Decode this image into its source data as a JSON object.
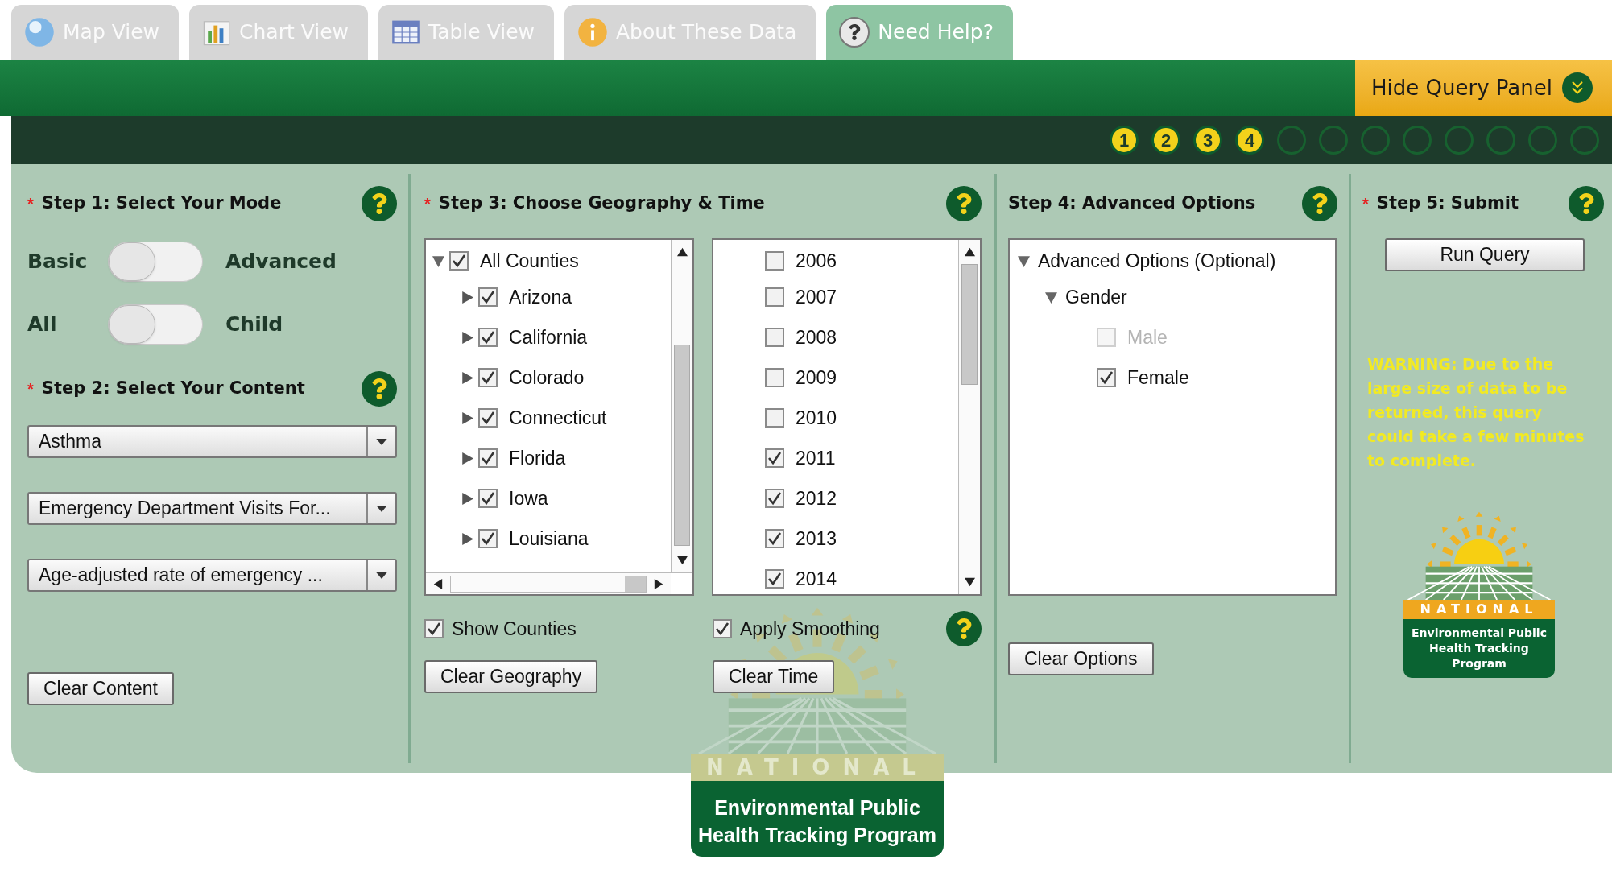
{
  "tabs": [
    {
      "label": "Map View",
      "selected": false
    },
    {
      "label": "Chart View",
      "selected": false
    },
    {
      "label": "Table View",
      "selected": false
    },
    {
      "label": "About These Data",
      "selected": false
    },
    {
      "label": "Need Help?",
      "selected": true
    }
  ],
  "hide_panel": {
    "label": "Hide Query Panel"
  },
  "steps": [
    {
      "label": "1",
      "done": true
    },
    {
      "label": "2",
      "done": true
    },
    {
      "label": "3",
      "done": true
    },
    {
      "label": "4",
      "done": true
    },
    {
      "done": false
    },
    {
      "done": false
    },
    {
      "done": false
    },
    {
      "done": false
    },
    {
      "done": false
    },
    {
      "done": false
    },
    {
      "done": false
    },
    {
      "done": false
    }
  ],
  "step1": {
    "title": "Step 1: Select Your Mode",
    "marker": "*",
    "toggles": [
      {
        "left": "Basic",
        "right": "Advanced",
        "on": false
      },
      {
        "left": "All",
        "right": "Child",
        "on": false
      }
    ]
  },
  "step2": {
    "title": "Step 2: Select Your Content",
    "marker": "*",
    "dropdowns": [
      "Asthma",
      "Emergency Department Visits For...",
      "Age-adjusted rate of emergency ..."
    ],
    "clear": "Clear Content"
  },
  "step3": {
    "title": "Step 3: Choose Geography & Time",
    "marker": "*",
    "geography": {
      "label": "All Counties",
      "checked": true,
      "expanded": true,
      "children": [
        {
          "label": "Arizona",
          "checked": true,
          "expanded": false
        },
        {
          "label": "California",
          "checked": true,
          "expanded": false
        },
        {
          "label": "Colorado",
          "checked": true,
          "expanded": false
        },
        {
          "label": "Connecticut",
          "checked": true,
          "expanded": false
        },
        {
          "label": "Florida",
          "checked": true,
          "expanded": false
        },
        {
          "label": "Iowa",
          "checked": true,
          "expanded": false
        },
        {
          "label": "Louisiana",
          "checked": true,
          "expanded": false
        }
      ]
    },
    "years": [
      {
        "label": "2006",
        "checked": false
      },
      {
        "label": "2007",
        "checked": false
      },
      {
        "label": "2008",
        "checked": false
      },
      {
        "label": "2009",
        "checked": false
      },
      {
        "label": "2010",
        "checked": false
      },
      {
        "label": "2011",
        "checked": true
      },
      {
        "label": "2012",
        "checked": true
      },
      {
        "label": "2013",
        "checked": true
      },
      {
        "label": "2014",
        "checked": true
      }
    ],
    "show_counties": {
      "label": "Show Counties",
      "checked": true
    },
    "smoothing": {
      "label": "Apply Smoothing",
      "checked": true
    },
    "clear_geography": "Clear Geography",
    "clear_time": "Clear Time"
  },
  "step4": {
    "title": "Step 4: Advanced Options",
    "tree": {
      "label": "Advanced Options (Optional)",
      "expanded": true,
      "children": [
        {
          "label": "Gender",
          "expanded": true,
          "children": [
            {
              "label": "Male",
              "checked": false,
              "disabled": true
            },
            {
              "label": "Female",
              "checked": true,
              "disabled": false
            }
          ]
        }
      ]
    },
    "clear": "Clear Options"
  },
  "step5": {
    "title": "Step 5: Submit",
    "marker": "*",
    "button": "Run Query",
    "warning": "WARNING: Due to the large size of data to be returned, this query could take a few minutes to complete.",
    "logo": {
      "band": "NATIONAL",
      "name": "Environmental Public Health Tracking Program"
    }
  },
  "footer_logo": {
    "band": "NATIONAL",
    "name": "Environmental Public Health Tracking Program"
  }
}
